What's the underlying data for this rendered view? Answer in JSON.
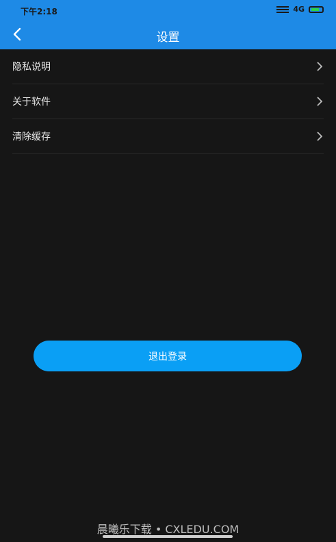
{
  "status_bar": {
    "time": "下午2:18",
    "network": "4G"
  },
  "header": {
    "title": "设置",
    "back_icon": "chevron-left-icon"
  },
  "menu": {
    "items": [
      {
        "label": "隐私说明",
        "icon": "chevron-right-icon"
      },
      {
        "label": "关于软件",
        "icon": "chevron-right-icon"
      },
      {
        "label": "清除缓存",
        "icon": "chevron-right-icon"
      }
    ]
  },
  "logout": {
    "label": "退出登录"
  },
  "watermark": {
    "text": "晨曦乐下载 • CXLEDU.COM"
  },
  "colors": {
    "header": "#1e8ae6",
    "background": "#161616",
    "button": "#0a9ff5"
  }
}
